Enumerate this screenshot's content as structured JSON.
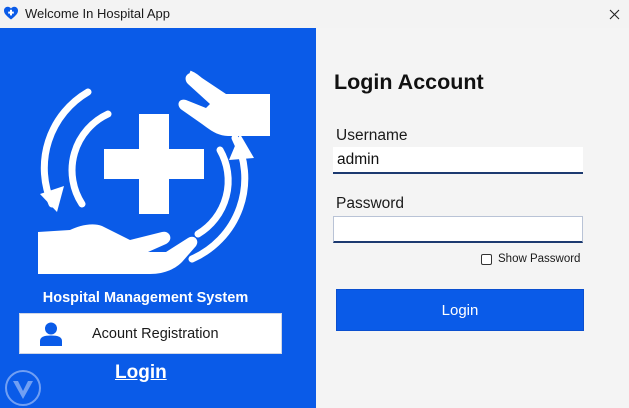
{
  "window": {
    "title": "Welcome In Hospital App",
    "app_icon": "heart-cross-icon",
    "close_icon": "close-icon"
  },
  "left": {
    "logo_icon": "hands-medical-cross-cycle-icon",
    "system_title": "Hospital Management System",
    "registration_button": {
      "icon": "user-icon",
      "label": "Acount Registration"
    },
    "login_link": "Login",
    "watermark_icon": "watermark-logo-icon"
  },
  "right": {
    "heading": "Login Account",
    "username": {
      "label": "Username",
      "value": "admin"
    },
    "password": {
      "label": "Password",
      "value": ""
    },
    "show_password": {
      "label": "Show Password",
      "checked": false
    },
    "login_button": "Login"
  },
  "colors": {
    "brand_blue": "#0a5be8",
    "titlebar": "#f3f3f3",
    "input_underline": "#1c3a70",
    "white": "#ffffff"
  }
}
